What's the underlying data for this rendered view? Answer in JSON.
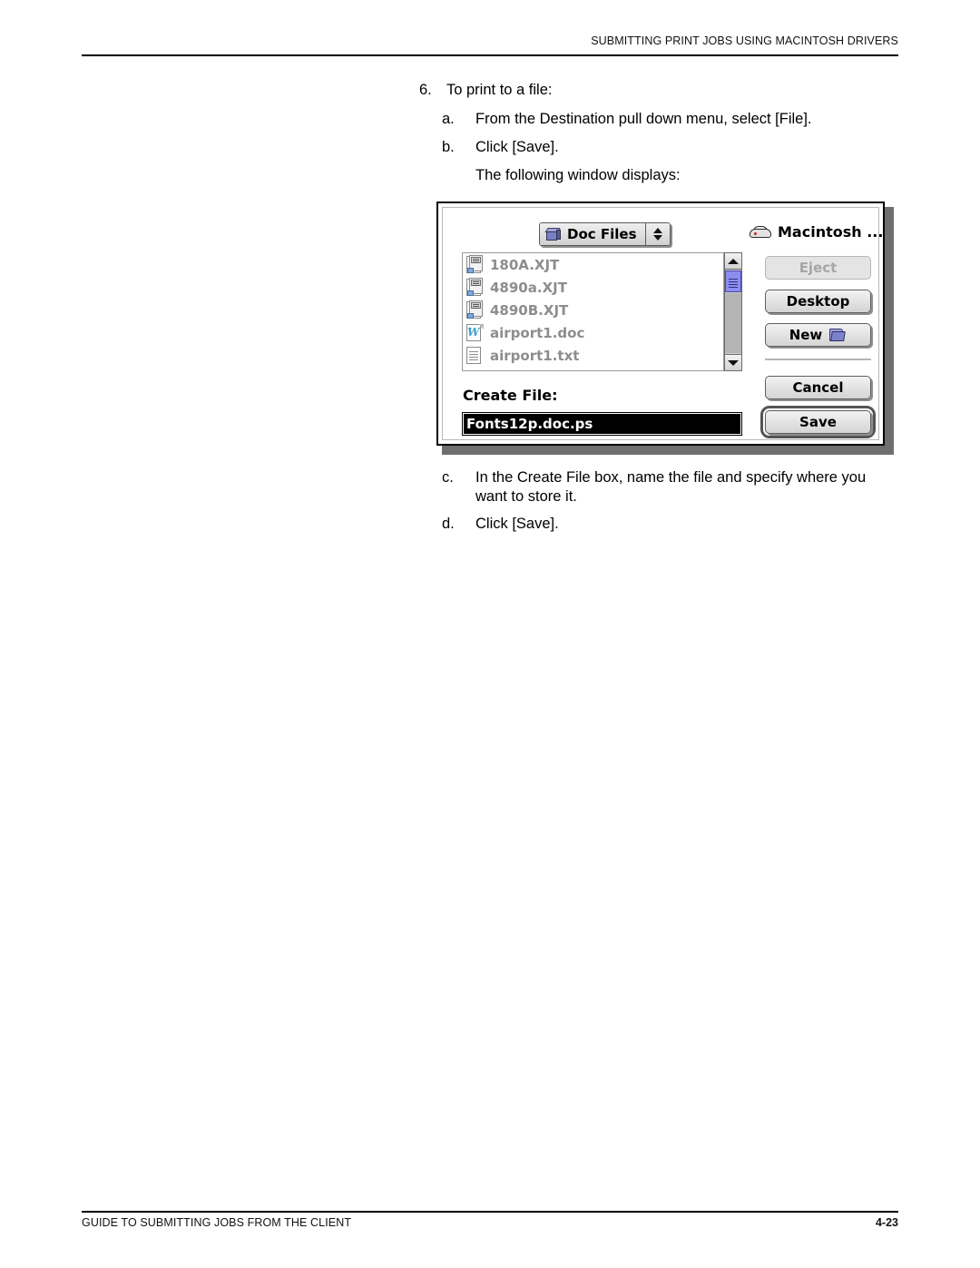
{
  "header": {
    "running_head": "SUBMITTING PRINT JOBS USING MACINTOSH DRIVERS"
  },
  "footer": {
    "running_foot": "GUIDE TO SUBMITTING JOBS FROM THE CLIENT",
    "page_number": "4-23"
  },
  "steps": {
    "step6": {
      "marker": "6.",
      "text": "To print to a file:"
    },
    "stepa": {
      "marker": "a.",
      "text": "From the Destination pull down menu, select [File]."
    },
    "stepb": {
      "marker": "b.",
      "text": "Click [Save]."
    },
    "note": {
      "text": "The following window displays:"
    },
    "stepc": {
      "marker": "c.",
      "text": "In the Create File box, name the file and specify where you want to store it."
    },
    "stepd": {
      "marker": "d.",
      "text": "Click [Save]."
    }
  },
  "dialog": {
    "location_popup": {
      "label": "Doc Files",
      "icon": "folder-box-icon",
      "arrows_icon": "up-down-arrows-icon"
    },
    "volume": {
      "name": "Macintosh ...",
      "icon": "hard-disk-icon"
    },
    "file_list": [
      {
        "name": "180A.XJT",
        "icon": "xjt-document-icon"
      },
      {
        "name": "4890a.XJT",
        "icon": "xjt-document-icon"
      },
      {
        "name": "4890B.XJT",
        "icon": "xjt-document-icon"
      },
      {
        "name": "airport1.doc",
        "icon": "word-document-icon"
      },
      {
        "name": "airport1.txt",
        "icon": "text-document-icon"
      }
    ],
    "scrollbar": {
      "up_arrow_icon": "scroll-up-arrow-icon",
      "down_arrow_icon": "scroll-down-arrow-icon",
      "thumb_color": "#8d8df0"
    },
    "create_file": {
      "label": "Create File:",
      "value": "Fonts12p.doc.ps"
    },
    "buttons": {
      "eject": "Eject",
      "desktop": "Desktop",
      "new": "New",
      "new_icon": "new-folder-icon",
      "cancel": "Cancel",
      "save": "Save"
    }
  },
  "colors": {
    "list_text": "#8d8d8d",
    "scroll_thumb": "#8d8df0",
    "selection_bg": "#000000",
    "selection_fg": "#ffffff"
  }
}
